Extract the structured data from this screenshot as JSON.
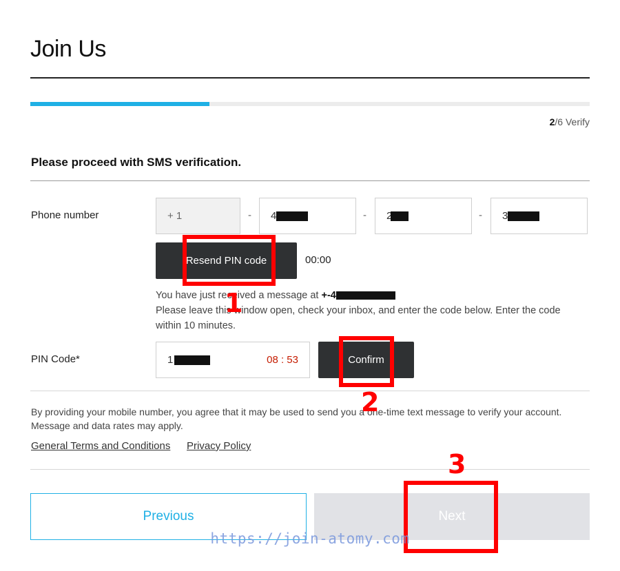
{
  "page": {
    "title": "Join Us",
    "step_current": "2",
    "step_rest": "/6 Verify",
    "progress_fraction": 0.32
  },
  "sms": {
    "section_title": "Please proceed with SMS verification.",
    "phone_label": "Phone number",
    "country_code": "+ 1",
    "phone_part1": "4",
    "phone_part2": "2",
    "phone_part3": "3",
    "dash": "-",
    "resend_label": "Resend PIN code",
    "resend_timer": "00:00",
    "message_line1_prefix": "You have just received a message at",
    "message_line1_number": "+-4",
    "message_line2": "Please leave this window open, check your inbox, and enter the code below. Enter the code",
    "message_line3": "within 10 minutes.",
    "pin_label": "PIN Code*",
    "pin_value": "1",
    "pin_timer": "08 : 53",
    "confirm_label": "Confirm"
  },
  "legal": {
    "disclaimer_line1": "By providing your mobile number, you agree that it may be used to send you a one-time text message to verify your account.",
    "disclaimer_line2": "Message and data rates may apply.",
    "terms_link": "General Terms and Conditions",
    "privacy_link": "Privacy Policy"
  },
  "nav": {
    "previous_label": "Previous",
    "next_label": "Next"
  },
  "annotations": {
    "n1": "1",
    "n2": "2",
    "n3": "3",
    "color": "#ff0000"
  },
  "watermark": "https://join-atomy.com",
  "colors": {
    "accent": "#1fb0e5",
    "dark_button": "#2f3133",
    "disabled_button": "#e1e2e6",
    "timer_red": "#c51c00"
  }
}
